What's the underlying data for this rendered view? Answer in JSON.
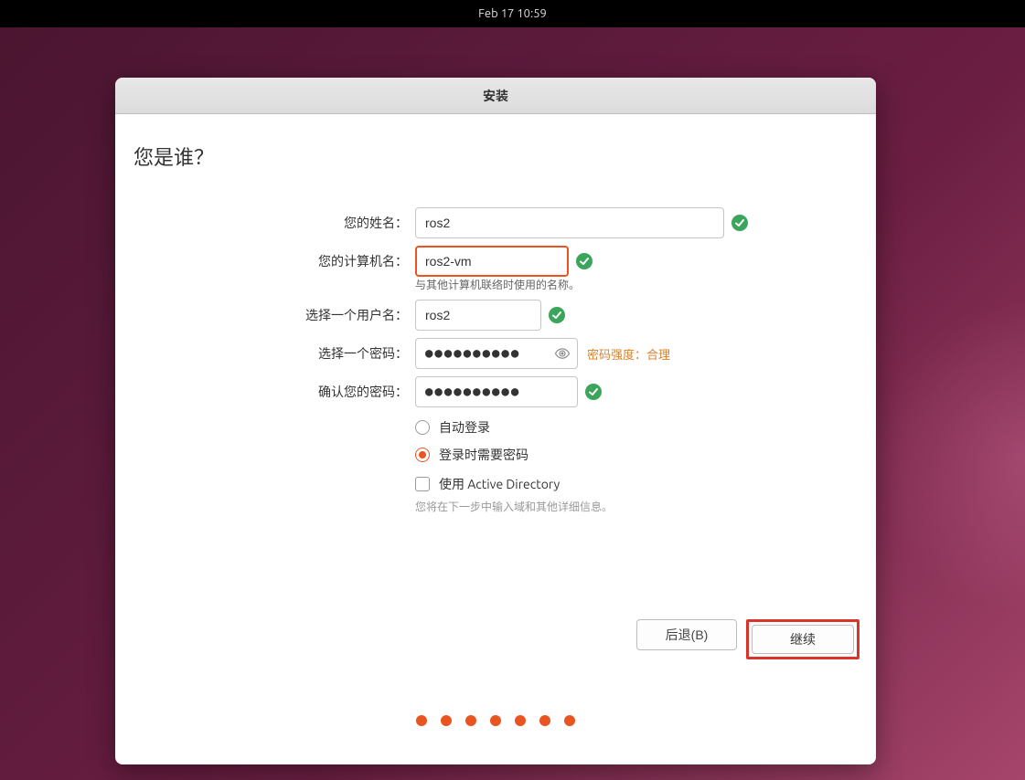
{
  "topbar": {
    "datetime": "Feb 17  10:59"
  },
  "window": {
    "title": "安装"
  },
  "page": {
    "heading": "您是谁？"
  },
  "form": {
    "name": {
      "label": "您的姓名：",
      "value": "ros2"
    },
    "hostname": {
      "label": "您的计算机名：",
      "value": "ros2-vm",
      "helper": "与其他计算机联络时使用的名称。"
    },
    "username": {
      "label": "选择一个用户名：",
      "value": "ros2"
    },
    "password": {
      "label": "选择一个密码：",
      "value": "●●●●●●●●●●",
      "strength": "密码强度：合理"
    },
    "confirm_password": {
      "label": "确认您的密码：",
      "value": "●●●●●●●●●●"
    },
    "login_options": {
      "auto_login": "自动登录",
      "require_password": "登录时需要密码",
      "selected": "require_password"
    },
    "active_directory": {
      "label": "使用 Active Directory",
      "helper": "您将在下一步中输入域和其他详细信息。",
      "checked": false
    }
  },
  "buttons": {
    "back": "后退(B)",
    "continue": "继续"
  },
  "progress": {
    "total_dots": 7
  },
  "colors": {
    "accent": "#e95420",
    "success": "#3ba55c",
    "highlight": "#d9332a",
    "warning": "#d9822b"
  }
}
